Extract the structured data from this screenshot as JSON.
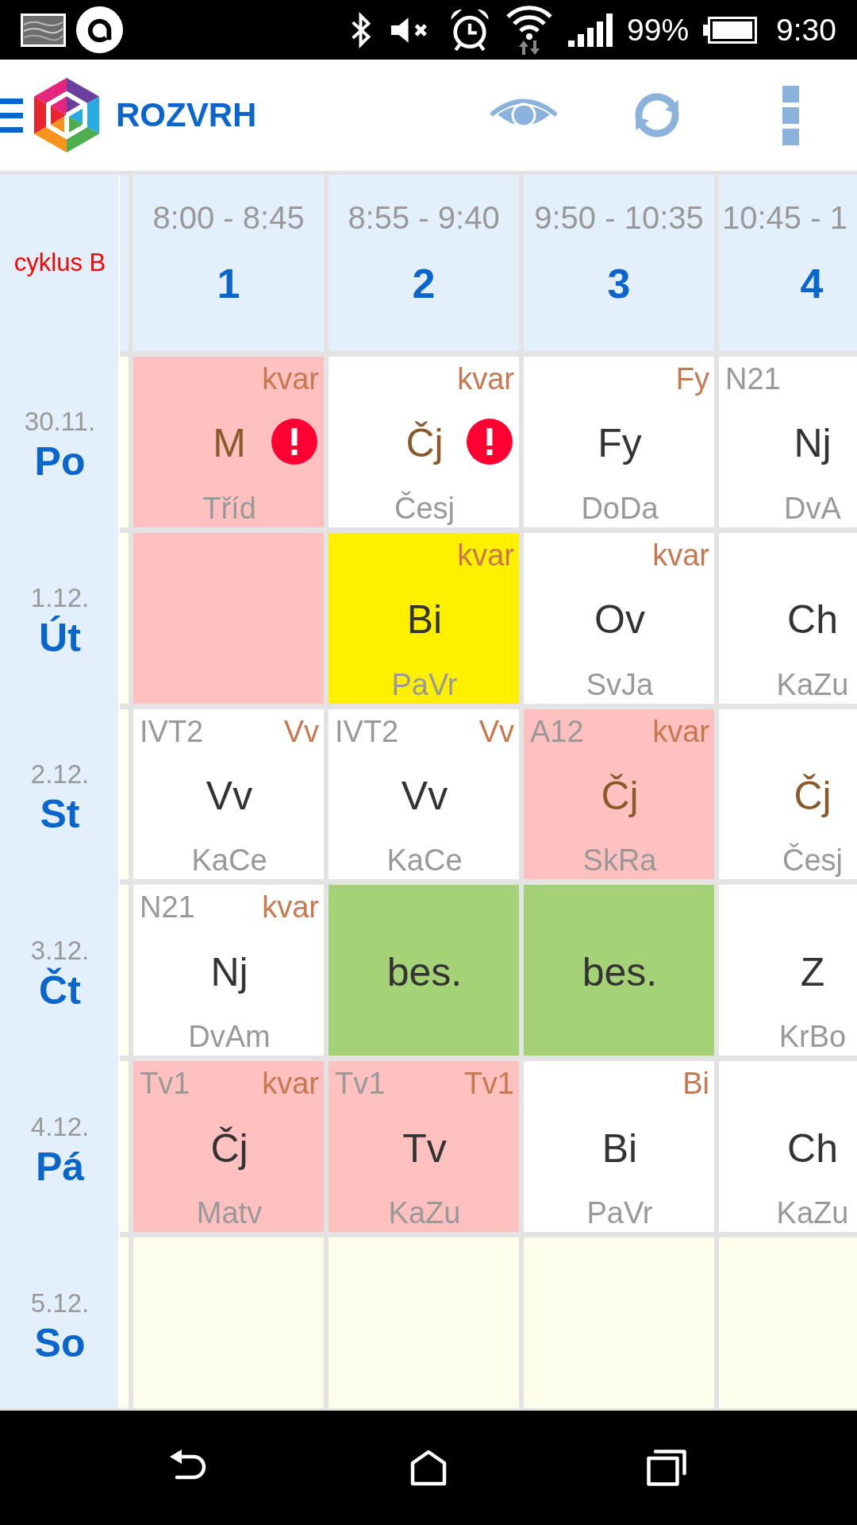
{
  "status_bar": {
    "battery": "99%",
    "time": "9:30"
  },
  "app_bar": {
    "title": "ROZVRH"
  },
  "timetable": {
    "cycle": "cyklus B",
    "periods": [
      {
        "time": "8:00 - 8:45",
        "number": "1"
      },
      {
        "time": "8:55 - 9:40",
        "number": "2"
      },
      {
        "time": "9:50 - 10:35",
        "number": "3"
      },
      {
        "time": "10:45 - 1",
        "number": "4"
      }
    ],
    "days": [
      {
        "date": "30.11.",
        "name": "Po",
        "lessons": [
          {
            "group": "kvar",
            "subject": "M",
            "teacher": "Tříd",
            "color": "#ffc0c0",
            "highlighted": true,
            "alert": true
          },
          {
            "group": "kvar",
            "subject": "Čj",
            "teacher": "Česj",
            "color": "#ffffff",
            "highlighted": true,
            "alert": true
          },
          {
            "group": "Fy",
            "subject": "Fy",
            "teacher": "DoDa",
            "color": "#ffffff",
            "highlighted": false,
            "alert": false
          },
          {
            "room": "N21",
            "subject": "Nj",
            "teacher": "DvA",
            "color": "#ffffff",
            "highlighted": false,
            "alert": false
          }
        ]
      },
      {
        "date": "1.12.",
        "name": "Út",
        "lessons": [
          {
            "color": "#ffc0c0",
            "alert": false
          },
          {
            "group": "kvar",
            "subject": "Bi",
            "teacher": "PaVr",
            "color": "#fff000",
            "highlighted": false,
            "alert": false
          },
          {
            "group": "kvar",
            "subject": "Ov",
            "teacher": "SvJa",
            "color": "#ffffff",
            "highlighted": false,
            "alert": false
          },
          {
            "subject": "Ch",
            "teacher": "KaZu",
            "color": "#ffffff",
            "highlighted": false,
            "alert": false
          }
        ]
      },
      {
        "date": "2.12.",
        "name": "St",
        "lessons": [
          {
            "room": "IVT2",
            "group": "Vv",
            "subject": "Vv",
            "teacher": "KaCe",
            "color": "#ffffff",
            "highlighted": false,
            "alert": false
          },
          {
            "room": "IVT2",
            "group": "Vv",
            "subject": "Vv",
            "teacher": "KaCe",
            "color": "#ffffff",
            "highlighted": false,
            "alert": false
          },
          {
            "room": "A12",
            "group": "kvar",
            "subject": "Čj",
            "teacher": "SkRa",
            "color": "#ffc0c0",
            "highlighted": true,
            "alert": false
          },
          {
            "subject": "Čj",
            "teacher": "Česj",
            "color": "#ffffff",
            "highlighted": true,
            "alert": false
          }
        ]
      },
      {
        "date": "3.12.",
        "name": "Čt",
        "lessons": [
          {
            "room": "N21",
            "group": "kvar",
            "subject": "Nj",
            "teacher": "DvAm",
            "color": "#ffffff",
            "highlighted": false,
            "alert": false
          },
          {
            "subject": "bes.",
            "color": "#a5d277",
            "highlighted": false,
            "alert": false
          },
          {
            "subject": "bes.",
            "color": "#a5d277",
            "highlighted": false,
            "alert": false
          },
          {
            "subject": "Z",
            "teacher": "KrBo",
            "color": "#ffffff",
            "highlighted": false,
            "alert": false
          }
        ]
      },
      {
        "date": "4.12.",
        "name": "Pá",
        "lessons": [
          {
            "room": "Tv1",
            "group": "kvar",
            "subject": "Čj",
            "teacher": "Matv",
            "color": "#ffc0c0",
            "highlighted": false,
            "alert": false
          },
          {
            "room": "Tv1",
            "group": "Tv1",
            "subject": "Tv",
            "teacher": "KaZu",
            "color": "#ffc0c0",
            "highlighted": false,
            "alert": false
          },
          {
            "group": "Bi",
            "subject": "Bi",
            "teacher": "PaVr",
            "color": "#ffffff",
            "highlighted": false,
            "alert": false
          },
          {
            "subject": "Ch",
            "teacher": "KaZu",
            "color": "#ffffff",
            "highlighted": false,
            "alert": false
          }
        ]
      },
      {
        "date": "5.12.",
        "name": "So",
        "lessons": [
          {
            "color": "#fdfdeb",
            "alert": false
          },
          {
            "color": "#fdfdeb",
            "alert": false
          },
          {
            "color": "#fdfdeb",
            "alert": false
          },
          {
            "color": "#fdfdeb",
            "alert": false
          }
        ]
      }
    ]
  }
}
